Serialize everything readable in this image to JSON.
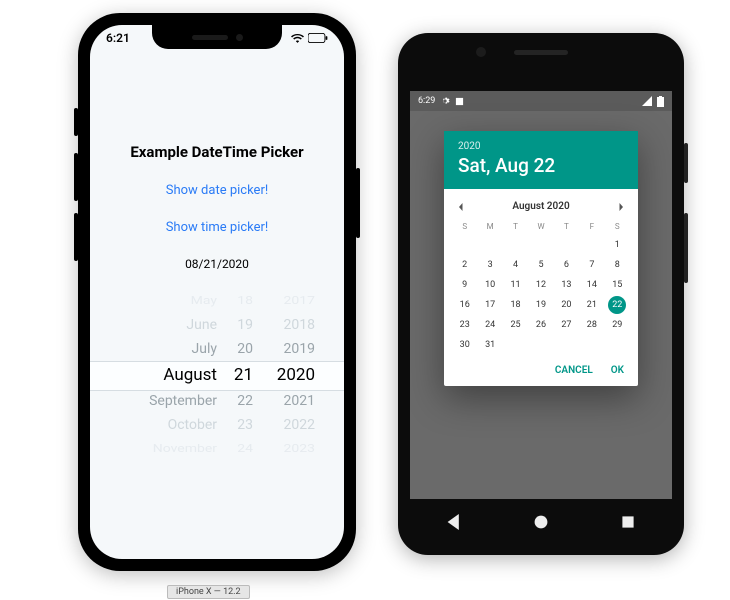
{
  "ios": {
    "status_time": "6:21",
    "title": "Example DateTime Picker",
    "link_date": "Show date picker!",
    "link_time": "Show time picker!",
    "date_text": "08/21/2020",
    "wheel": {
      "months": [
        "May",
        "June",
        "July",
        "August",
        "September",
        "October",
        "November"
      ],
      "days": [
        "18",
        "19",
        "20",
        "21",
        "22",
        "23",
        "24"
      ],
      "years": [
        "2017",
        "2018",
        "2019",
        "2020",
        "2021",
        "2022",
        "2023"
      ]
    },
    "caption": "iPhone X — 12.2"
  },
  "android": {
    "status_time": "6:29",
    "dialog": {
      "year": "2020",
      "headline": "Sat, Aug 22",
      "month_title": "August 2020",
      "dow": [
        "S",
        "M",
        "T",
        "W",
        "T",
        "F",
        "S"
      ],
      "first_weekday_index": 6,
      "days_in_month": 31,
      "selected_day": 22,
      "cancel": "CANCEL",
      "ok": "OK"
    }
  },
  "colors": {
    "ios_link": "#2a7bf6",
    "teal": "#009688"
  }
}
